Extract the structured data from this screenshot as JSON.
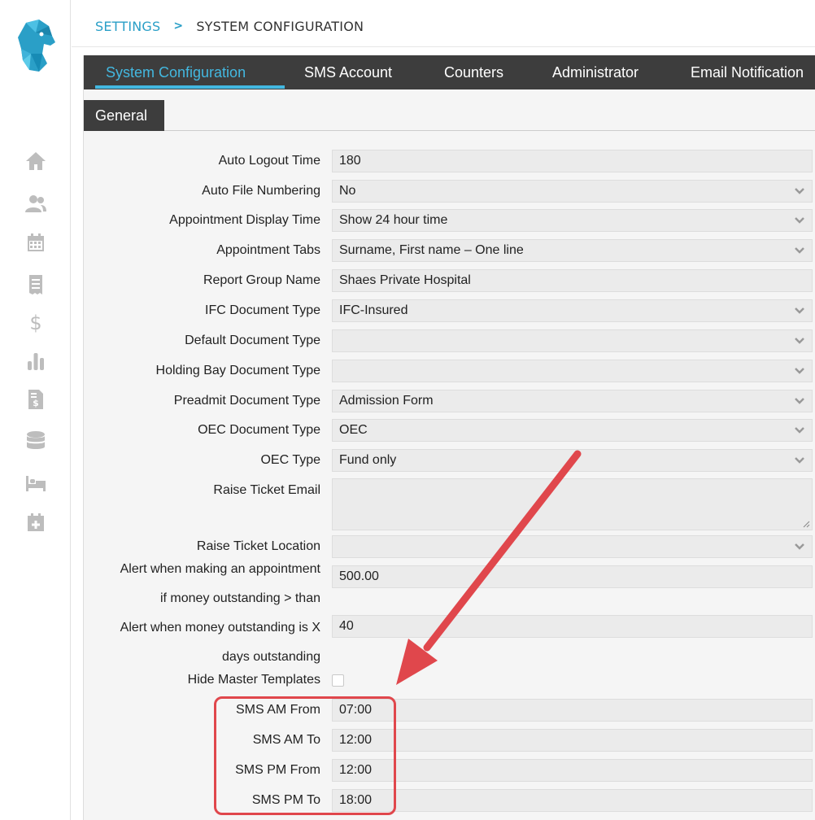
{
  "sidebar": {
    "icons": [
      "home-icon",
      "users-icon",
      "calendar-icon",
      "receipt-icon",
      "dollar-icon",
      "bar-chart-icon",
      "invoice-icon",
      "database-icon",
      "bed-icon",
      "calendar-plus-icon"
    ],
    "accent": "#2a9fc7"
  },
  "breadcrumb": {
    "parent": "SETTINGS",
    "separator": ">",
    "current": "SYSTEM CONFIGURATION"
  },
  "tabs": [
    {
      "label": "System Configuration",
      "active": true
    },
    {
      "label": "SMS Account",
      "active": false
    },
    {
      "label": "Counters",
      "active": false
    },
    {
      "label": "Administrator",
      "active": false
    },
    {
      "label": "Email Notification",
      "active": false
    }
  ],
  "subtabs": [
    {
      "label": "General",
      "active": true
    }
  ],
  "form": {
    "auto_logout_time": {
      "label": "Auto Logout Time",
      "value": "180"
    },
    "auto_file_numbering": {
      "label": "Auto File Numbering",
      "value": "No"
    },
    "appointment_display_time": {
      "label": "Appointment Display Time",
      "value": "Show 24 hour time"
    },
    "appointment_tabs": {
      "label": "Appointment Tabs",
      "value": "Surname, First name – One line"
    },
    "report_group_name": {
      "label": "Report Group Name",
      "value": "Shaes Private Hospital"
    },
    "ifc_document_type": {
      "label": "IFC Document Type",
      "value": "IFC-Insured"
    },
    "default_document_type": {
      "label": "Default Document Type",
      "value": ""
    },
    "holding_bay_document_type": {
      "label": "Holding Bay Document Type",
      "value": ""
    },
    "preadmit_document_type": {
      "label": "Preadmit Document Type",
      "value": "Admission Form"
    },
    "oec_document_type": {
      "label": "OEC Document Type",
      "value": "OEC"
    },
    "oec_type": {
      "label": "OEC Type",
      "value": "Fund only"
    },
    "raise_ticket_email": {
      "label": "Raise Ticket Email",
      "value": ""
    },
    "raise_ticket_location": {
      "label": "Raise Ticket Location",
      "value": ""
    },
    "alert_money_outstanding": {
      "label_line1": "Alert when making an appointment",
      "label_line2": "if money outstanding > than",
      "value": "500.00"
    },
    "alert_days_outstanding": {
      "label_line1": "Alert when money outstanding is X",
      "label_line2": "days outstanding",
      "value": "40"
    },
    "hide_master_templates": {
      "label": "Hide Master Templates",
      "checked": false
    },
    "sms_am_from": {
      "label": "SMS AM From",
      "value": "07:00"
    },
    "sms_am_to": {
      "label": "SMS AM To",
      "value": "12:00"
    },
    "sms_pm_from": {
      "label": "SMS PM From",
      "value": "12:00"
    },
    "sms_pm_to": {
      "label": "SMS PM To",
      "value": "18:00"
    }
  },
  "colors": {
    "tab_bar": "#3d3d3d",
    "tab_active": "#43b8e0",
    "annotation": "#e0474c",
    "field_bg": "#ebebeb"
  }
}
